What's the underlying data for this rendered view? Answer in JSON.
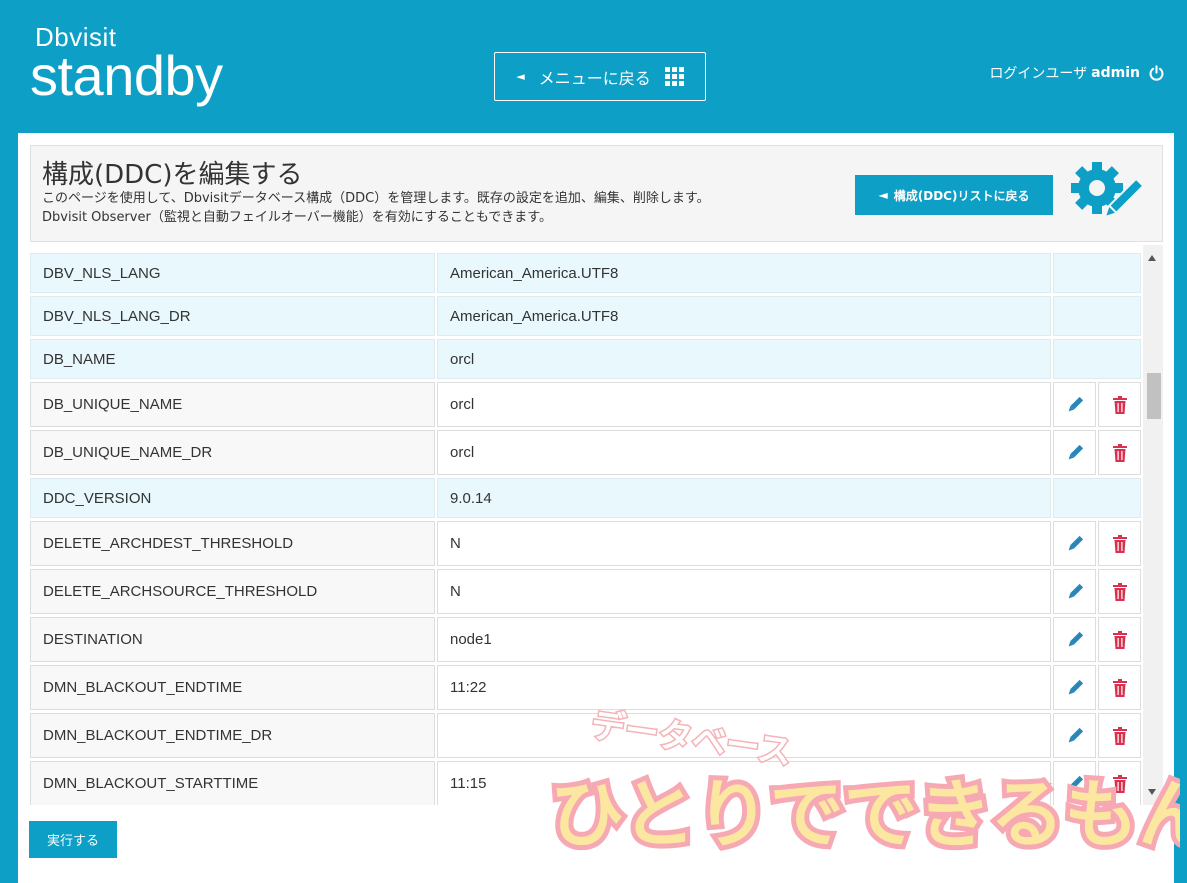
{
  "header": {
    "logo_small": "Dbvisit",
    "logo_big": "standby",
    "menu_back_label": "メニューに戻る",
    "user_label": "ログインユーザ",
    "user_name": "admin"
  },
  "page": {
    "title": "構成(DDC)を編集する",
    "desc_line1": "このページを使用して、Dbvisitデータベース構成（DDC）を管理します。既存の設定を追加、編集、削除します。",
    "desc_line2": "Dbvisit Observer（監視と自動フェイルオーバー機能）を有効にすることもできます。",
    "back_to_list_label": "構成(DDC)リストに戻る"
  },
  "rows": [
    {
      "name": "DBV_NLS_LANG",
      "value": "American_America.UTF8",
      "editable": false
    },
    {
      "name": "DBV_NLS_LANG_DR",
      "value": "American_America.UTF8",
      "editable": false
    },
    {
      "name": "DB_NAME",
      "value": "orcl",
      "editable": false
    },
    {
      "name": "DB_UNIQUE_NAME",
      "value": "orcl",
      "editable": true
    },
    {
      "name": "DB_UNIQUE_NAME_DR",
      "value": "orcl",
      "editable": true
    },
    {
      "name": "DDC_VERSION",
      "value": "9.0.14",
      "editable": false
    },
    {
      "name": "DELETE_ARCHDEST_THRESHOLD",
      "value": "N",
      "editable": true
    },
    {
      "name": "DELETE_ARCHSOURCE_THRESHOLD",
      "value": "N",
      "editable": true
    },
    {
      "name": "DESTINATION",
      "value": "node1",
      "editable": true
    },
    {
      "name": "DMN_BLACKOUT_ENDTIME",
      "value": "11:22",
      "editable": true
    },
    {
      "name": "DMN_BLACKOUT_ENDTIME_DR",
      "value": "",
      "editable": true
    },
    {
      "name": "DMN_BLACKOUT_STARTTIME",
      "value": "11:15",
      "editable": true
    }
  ],
  "execute_label": "実行する",
  "watermark": {
    "line1": "データベース",
    "line2": "ひとりでできるもん"
  },
  "colors": {
    "accent": "#0e9fc6",
    "readonly_row": "#e8f8fd",
    "edit_icon": "#2a86b8",
    "delete_icon": "#d9304f"
  },
  "icons": [
    "grid-icon",
    "power-icon",
    "gear-pencil-icon",
    "pencil-icon",
    "trash-icon"
  ]
}
